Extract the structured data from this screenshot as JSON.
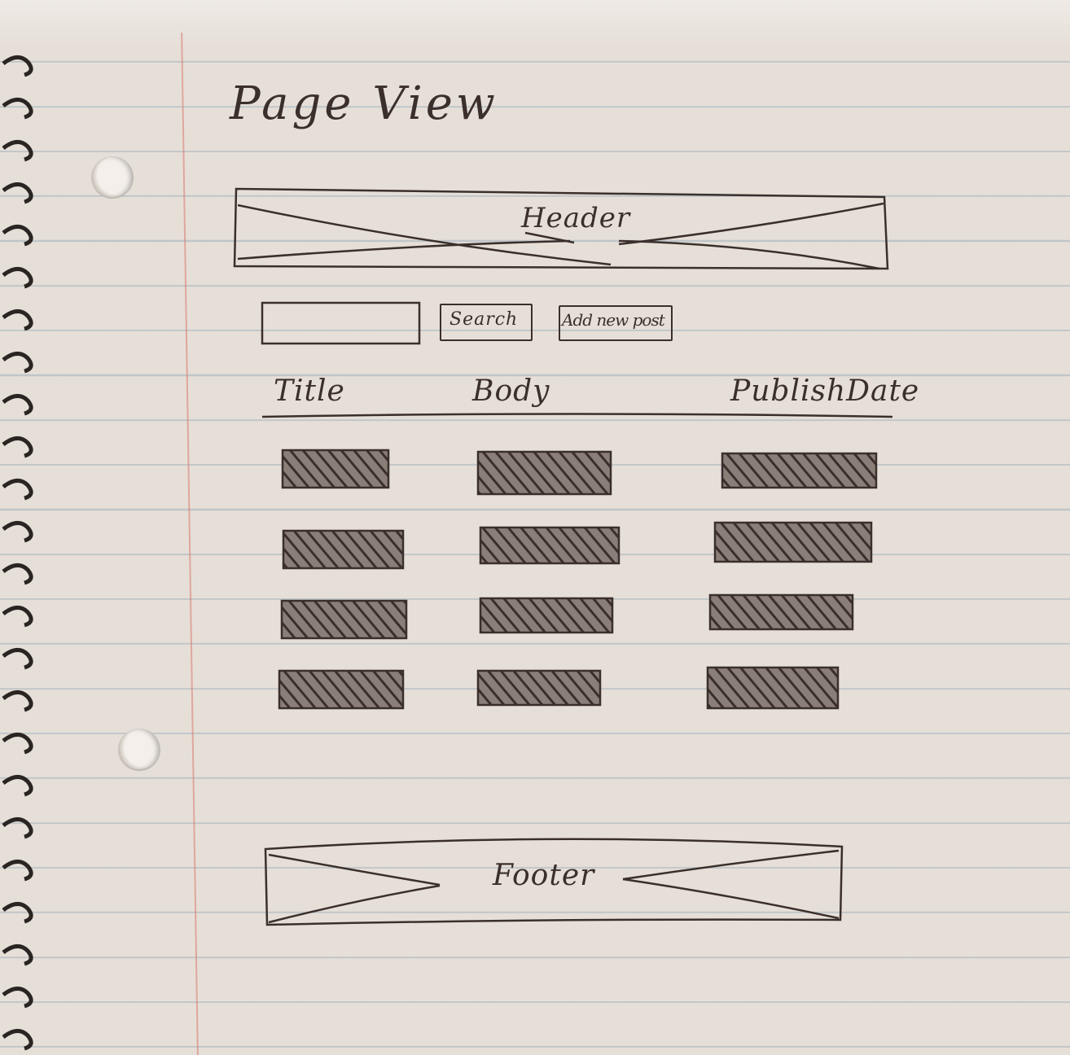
{
  "page": {
    "title": "Page View"
  },
  "header": {
    "label": "Header"
  },
  "toolbar": {
    "search_input_value": "",
    "search_label": "Search",
    "add_post_label": "Add new post"
  },
  "table": {
    "columns": [
      "Title",
      "Body",
      "PublishDate"
    ],
    "row_count": 4
  },
  "footer": {
    "label": "Footer"
  },
  "colors": {
    "ink": "#3b2f2c",
    "paper": "#e6dfd8",
    "rule_line": "#96a6b4",
    "margin_line": "#d7786e"
  }
}
